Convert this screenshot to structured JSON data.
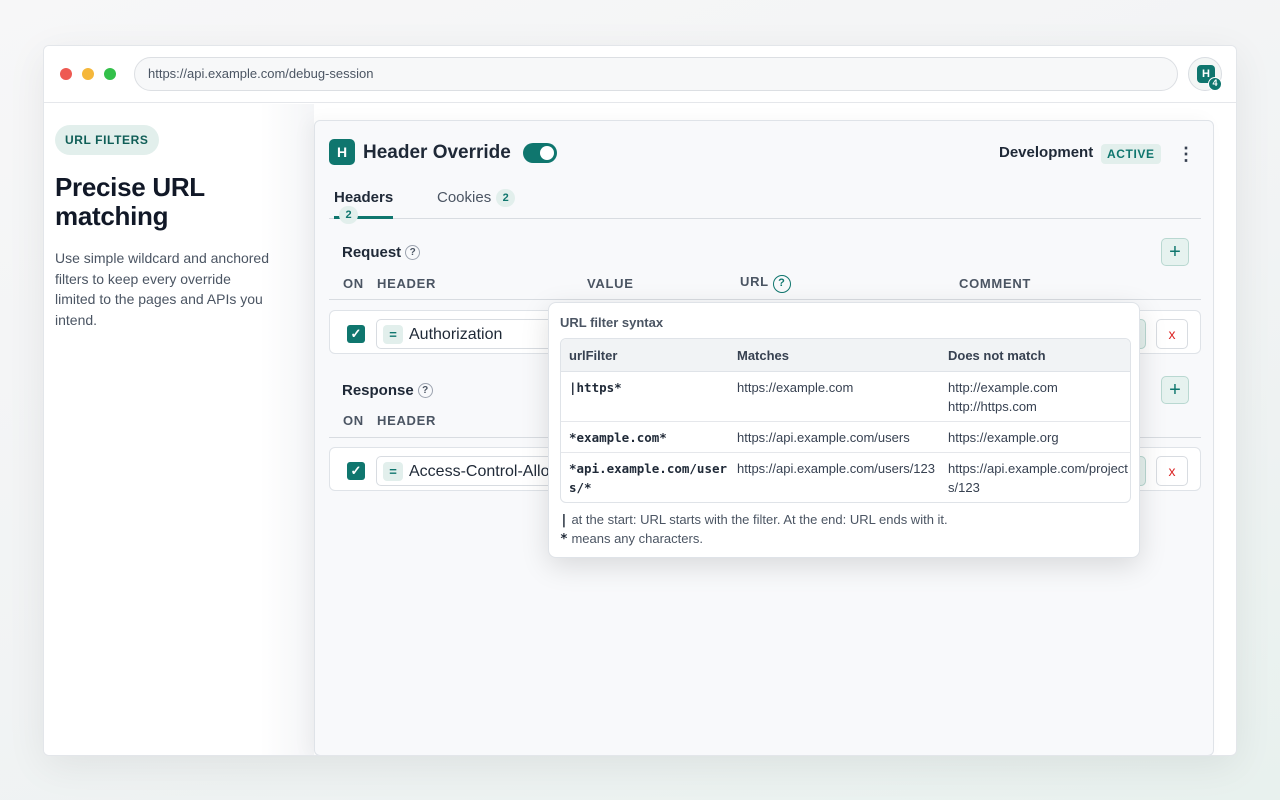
{
  "browser": {
    "url": "https://api.example.com/debug-session",
    "extension_logo_letter": "H",
    "extension_badge_count": "4"
  },
  "marketing": {
    "pill": "URL FILTERS",
    "heading": "Precise URL matching",
    "description": "Use simple wildcard and anchored filters to keep every override limited to the pages and APIs you intend."
  },
  "panel": {
    "logo_letter": "H",
    "title": "Header Override",
    "enabled": true,
    "profile_name": "Development",
    "profile_status": "ACTIVE",
    "tabs": [
      {
        "label": "Headers",
        "count": "2"
      },
      {
        "label": "Cookies",
        "count": "2"
      }
    ],
    "request": {
      "title": "Request",
      "help_icon": "?",
      "columns": {
        "on": "ON",
        "header": "HEADER",
        "value": "VALUE",
        "url": "URL",
        "comment": "COMMENT"
      },
      "rows": [
        {
          "checked": true,
          "operator": "=",
          "header": "Authorization"
        }
      ]
    },
    "response": {
      "title": "Response",
      "help_icon": "?",
      "columns": {
        "on": "ON",
        "header": "HEADER"
      },
      "rows": [
        {
          "checked": true,
          "operator": "=",
          "header": "Access-Control-Allo"
        }
      ]
    },
    "add_label": "+",
    "delete_label": "x"
  },
  "popover": {
    "title": "URL filter syntax",
    "columns": [
      "urlFilter",
      "Matches",
      "Does not match"
    ],
    "rows": [
      {
        "filter": "|https*",
        "matches": "https://example.com",
        "not_match": "http://example.com\nhttp://https.com"
      },
      {
        "filter": "*example.com*",
        "matches": "https://api.example.com/users",
        "not_match": "https://example.org"
      },
      {
        "filter": "*api.example.com/users/*",
        "matches": "https://api.example.com/users/123",
        "not_match": "https://api.example.com/projects/123"
      }
    ],
    "note_pipe_symbol": "|",
    "note_pipe_text": " at the start: URL starts with the filter. At the end: URL ends with it.",
    "note_star_symbol": "*",
    "note_star_text": " means any characters."
  },
  "colors": {
    "accent": "#0f766e",
    "accent_soft": "#e2efec",
    "danger": "#dc2626"
  },
  "icons": [
    "close-dot",
    "minimize-dot",
    "maximize-dot",
    "extension-icon",
    "toggle-switch",
    "more-vertical-icon",
    "help-icon",
    "plus-icon",
    "checkbox-icon",
    "equals-icon",
    "close-icon"
  ]
}
